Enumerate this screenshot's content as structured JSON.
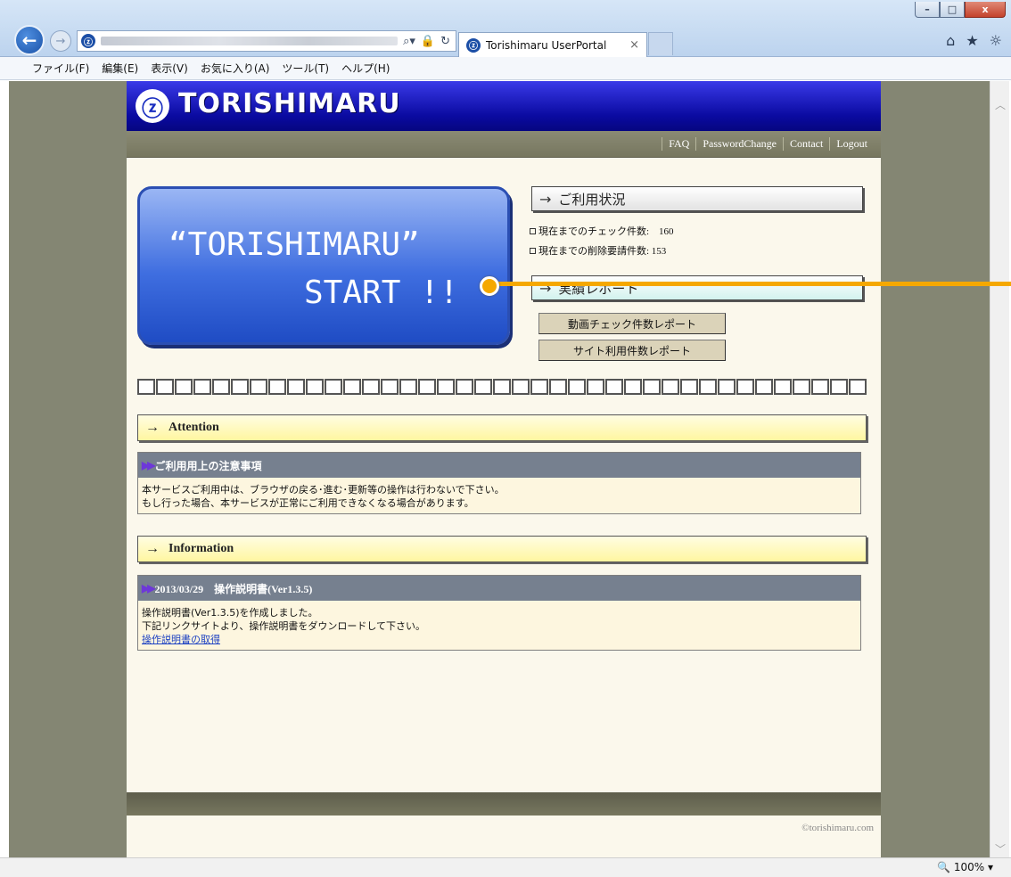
{
  "browser": {
    "tab_title": "Torishimaru UserPortal",
    "tab_close": "×",
    "back": "←",
    "forward": "→",
    "favicon": "ⓩ",
    "menu": [
      "ファイル(F)",
      "編集(E)",
      "表示(V)",
      "お気に入り(A)",
      "ツール(T)",
      "ヘルプ(H)"
    ],
    "window_controls": {
      "minimize": "–",
      "restore": "□",
      "close": "x"
    },
    "address_icons": {
      "search": "⌕▾",
      "lock": "🔒",
      "refresh": "↻"
    },
    "tool_icons": {
      "home": "⌂",
      "favorites": "★",
      "settings": "☼"
    },
    "zoom": "🔍 100%  ▾"
  },
  "site": {
    "brand": "TORISHIMARU",
    "brand_mark": "ⓩ",
    "toplinks": [
      "FAQ",
      "PasswordChange",
      "Contact",
      "Logout"
    ],
    "start_line1": "“TORISHIMARU”",
    "start_line2": "START !!",
    "usage": {
      "title": "ご利用状況",
      "check_count": "現在までのチェック件数:　160",
      "delete_count": "現在までの削除要請件数: 153"
    },
    "report": {
      "title": "実績レポート",
      "btn_video": "動画チェック件数レポート",
      "btn_site": "サイト利用件数レポート"
    },
    "attention": {
      "bar": "Attention",
      "head": "ご利用用上の注意事項",
      "line1": "本サービスご利用中は、ブラウザの戻る･進む･更新等の操作は行わないで下さい。",
      "line2": "もし行った場合、本サービスが正常にご利用できなくなる場合があります。"
    },
    "information": {
      "bar": "Information",
      "head": "2013/03/29　操作説明書(Ver1.3.5)",
      "line1": "操作説明書(Ver1.3.5)を作成しました。",
      "line2": "下記リンクサイトより、操作説明書をダウンロードして下さい。",
      "link": "操作説明書の取得"
    },
    "copyright": "©torishimaru.com"
  }
}
